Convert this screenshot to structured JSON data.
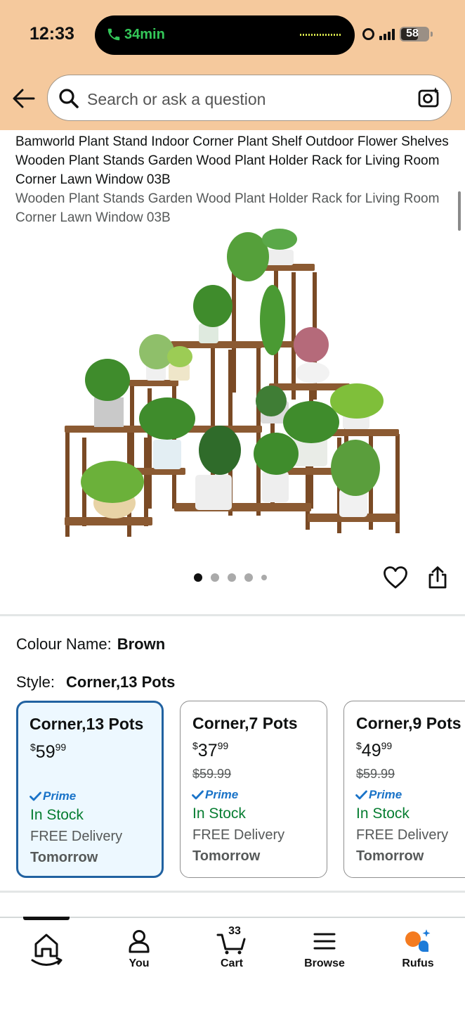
{
  "status_bar": {
    "time": "12:33",
    "call_timer": "34min",
    "battery": "58"
  },
  "search": {
    "placeholder": "Search or ask a question"
  },
  "product": {
    "title": "Bamworld Plant Stand Indoor Corner Plant Shelf Outdoor Flower Shelves Wooden Plant Stands Garden Wood Plant Holder Rack for Living Room Corner Lawn Window 03B",
    "subtitle": "Wooden Plant Stands Garden Wood Plant Holder Rack for Living Room Corner Lawn Window 03B",
    "image_count": 5,
    "active_image": 1
  },
  "variations": {
    "colour_label": "Colour Name:",
    "colour_value": "Brown",
    "style_label": "Style:",
    "style_value": "Corner,13 Pots",
    "options": [
      {
        "name": "Corner,13 Pots",
        "price_main": "59",
        "price_cents": "99",
        "currency": "$",
        "old_price": "",
        "prime": "Prime",
        "stock": "In Stock",
        "delivery": "FREE Delivery",
        "when": "Tomorrow",
        "selected": true
      },
      {
        "name": "Corner,7 Pots",
        "price_main": "37",
        "price_cents": "99",
        "currency": "$",
        "old_price": "$59.99",
        "prime": "Prime",
        "stock": "In Stock",
        "delivery": "FREE Delivery",
        "when": "Tomorrow",
        "selected": false
      },
      {
        "name": "Corner,9 Pots",
        "price_main": "49",
        "price_cents": "99",
        "currency": "$",
        "old_price": "$59.99",
        "prime": "Prime",
        "stock": "In Stock",
        "delivery": "FREE Delivery",
        "when": "Tomorrow",
        "selected": false
      }
    ]
  },
  "bottom_nav": {
    "items": [
      {
        "label": "",
        "icon": "home-icon",
        "active": true
      },
      {
        "label": "You",
        "icon": "person-icon"
      },
      {
        "label": "Cart",
        "icon": "cart-icon",
        "badge": "33"
      },
      {
        "label": "Browse",
        "icon": "menu-icon"
      },
      {
        "label": "Rufus",
        "icon": "rufus-icon"
      }
    ]
  },
  "colors": {
    "header_bg": "#f5c99d",
    "selected_border": "#2162a1",
    "selected_bg": "#edf8ff",
    "stock_green": "#067d31",
    "prime_blue": "#1a73c8"
  }
}
